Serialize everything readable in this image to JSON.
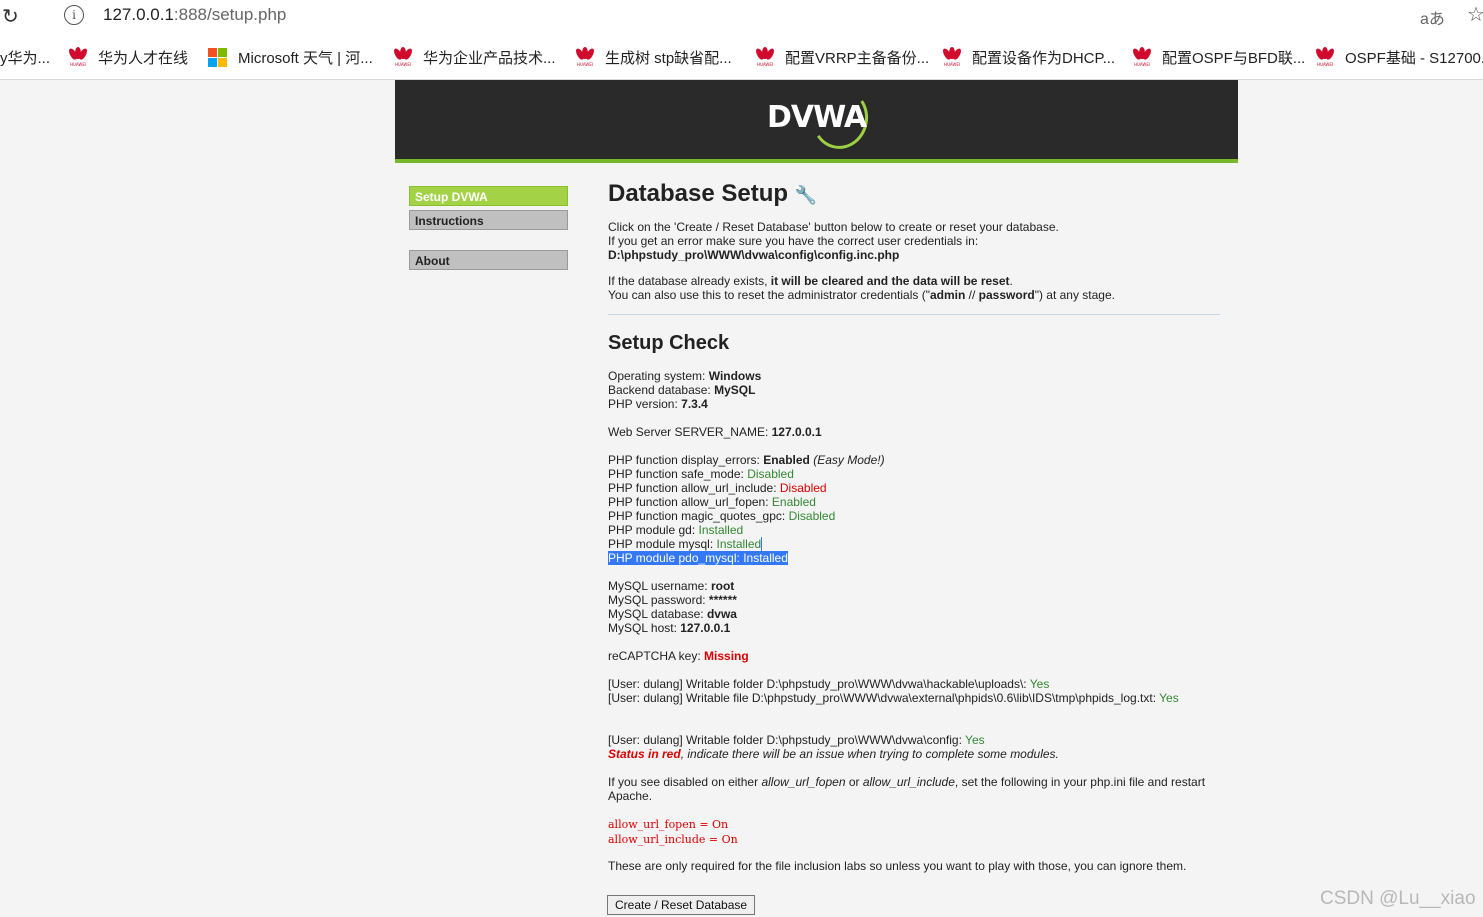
{
  "browser": {
    "url_host": "127.0.0.1",
    "url_rest": ":888/setup.php",
    "read_aloud": "aあ",
    "bookmarks": [
      {
        "label": "y华为...",
        "icon": "none"
      },
      {
        "label": "华为人才在线",
        "icon": "huawei-icon"
      },
      {
        "label": "Microsoft 天气 | 河...",
        "icon": "microsoft-icon"
      },
      {
        "label": "华为企业产品技术...",
        "icon": "huawei-icon"
      },
      {
        "label": "生成树 stp缺省配...",
        "icon": "huawei-icon"
      },
      {
        "label": "配置VRRP主备备份...",
        "icon": "huawei-icon"
      },
      {
        "label": "配置设备作为DHCP...",
        "icon": "huawei-icon"
      },
      {
        "label": "配置OSPF与BFD联...",
        "icon": "huawei-icon"
      },
      {
        "label": "OSPF基础 - S12700...",
        "icon": "huawei-icon"
      }
    ],
    "huawei_text": "HUAWEI"
  },
  "header": {
    "logo": "DVWA"
  },
  "menu": {
    "items": [
      "Setup DVWA",
      "Instructions",
      "About"
    ]
  },
  "content": {
    "title": "Database Setup",
    "intro1": "Click on the 'Create / Reset Database' button below to create or reset your database.",
    "intro2": "If you get an error make sure you have the correct user credentials in:",
    "config_path": "D:\\phpstudy_pro\\WWW\\dvwa\\config\\config.inc.php",
    "exists_pre": "If the database already exists, ",
    "exists_bold": "it will be cleared and the data will be reset",
    "exists_post": ".",
    "reset_pre": "You can also use this to reset the administrator credentials (\"",
    "reset_admin": "admin",
    "reset_sep": " // ",
    "reset_pass": "password",
    "reset_post": "\") at any stage.",
    "check_title": "Setup Check",
    "checks": {
      "os_label": "Operating system: ",
      "os_val": "Windows",
      "db_label": "Backend database: ",
      "db_val": "MySQL",
      "php_label": "PHP version: ",
      "php_val": "7.3.4",
      "server_label": "Web Server SERVER_NAME: ",
      "server_val": "127.0.0.1",
      "disp_label": "PHP function display_errors: ",
      "disp_val": "Enabled",
      "disp_note": "(Easy Mode!)",
      "safe_label": "PHP function safe_mode: ",
      "safe_val": "Disabled",
      "include_label": "PHP function allow_url_include: ",
      "include_val": "Disabled",
      "fopen_label": "PHP function allow_url_fopen: ",
      "fopen_val": "Enabled",
      "magic_label": "PHP function magic_quotes_gpc: ",
      "magic_val": "Disabled",
      "gd_label": "PHP module gd: ",
      "gd_val": "Installed",
      "mysql_label": "PHP module mysql: ",
      "mysql_val": "Installed",
      "pdo_label": "PHP module pdo_mysql: ",
      "pdo_val": "Installed",
      "user_label": "MySQL username: ",
      "user_val": "root",
      "pass_label": "MySQL password: ",
      "pass_val": "******",
      "dbname_label": "MySQL database: ",
      "dbname_val": "dvwa",
      "host_label": "MySQL host: ",
      "host_val": "127.0.0.1",
      "captcha_label": "reCAPTCHA key: ",
      "captcha_val": "Missing",
      "uploads_label": "[User: dulang] Writable folder D:\\phpstudy_pro\\WWW\\dvwa\\hackable\\uploads\\: ",
      "uploads_val": "Yes",
      "phpids_label": "[User: dulang] Writable file D:\\phpstudy_pro\\WWW\\dvwa\\external\\phpids\\0.6\\lib\\IDS\\tmp\\phpids_log.txt: ",
      "phpids_val": "Yes",
      "config_label": "[User: dulang] Writable folder D:\\phpstudy_pro\\WWW\\dvwa\\config: ",
      "config_val": "Yes"
    },
    "status_red": "Status in red",
    "status_rest": ", indicate there will be an issue when trying to complete some modules.",
    "disabled_pre": "If you see disabled on either ",
    "disabled_fopen": "allow_url_fopen",
    "disabled_or": " or ",
    "disabled_include": "allow_url_include",
    "disabled_post": ", set the following in your php.ini file and restart Apache.",
    "code1": "allow_url_fopen = On",
    "code2": "allow_url_include = On",
    "only_required": "These are only required for the file inclusion labs so unless you want to play with those, you can ignore them.",
    "button": "Create / Reset Database"
  },
  "watermark": "CSDN @Lu__xiao"
}
